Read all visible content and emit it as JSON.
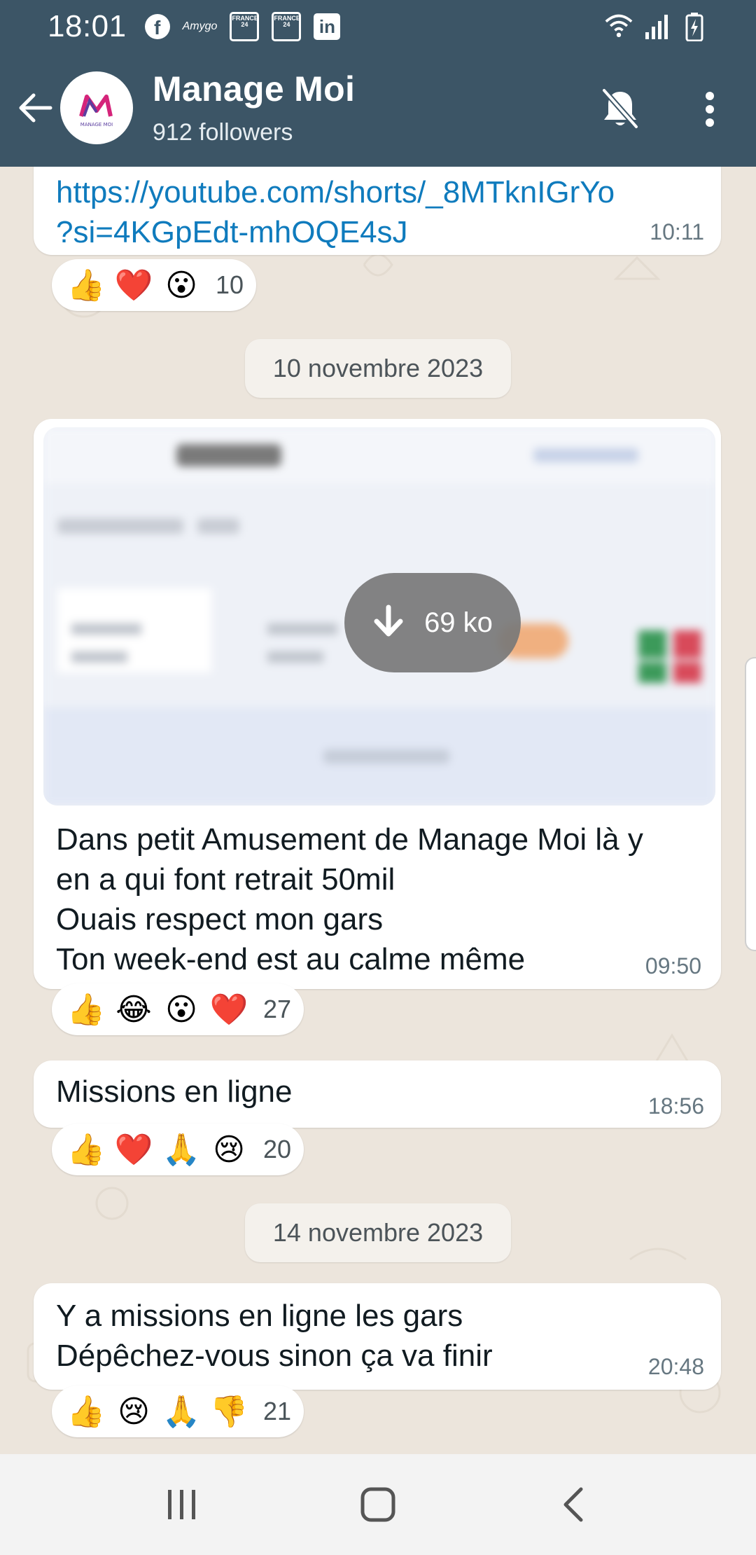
{
  "status_bar": {
    "time": "18:01",
    "notification_icons": [
      "facebook-icon",
      "amygo-icon",
      "france24-icon",
      "france24-icon",
      "linkedin-icon"
    ],
    "amygo_label": "Amygo",
    "france24_label": "FRANCE 24",
    "right_icons": [
      "wifi-icon",
      "signal-icon",
      "battery-charging-icon"
    ]
  },
  "header": {
    "title": "Manage Moi",
    "subtitle": "912 followers",
    "avatar_letter": "M",
    "avatar_caption": "MANAGE MOI",
    "actions": [
      "mute-notifications-icon",
      "more-options-icon"
    ]
  },
  "messages": [
    {
      "link_line1": "https://youtube.com/shorts/_8MTknIGrYo",
      "link_line2": "?si=4KGpEdt-mhOQE4sJ",
      "time": "10:11",
      "reactions": [
        "👍",
        "❤️",
        "😮"
      ],
      "reaction_count": "10"
    },
    {
      "date_separator": "10 novembre 2023"
    },
    {
      "image_size": "69 ko",
      "lines": [
        "Dans petit Amusement de Manage Moi là y",
        "en a qui font retrait 50mil",
        "Ouais respect mon gars",
        "Ton week-end est au calme même"
      ],
      "time": "09:50",
      "reactions": [
        "👍",
        "😂",
        "😮",
        "❤️"
      ],
      "reaction_count": "27"
    },
    {
      "text": "Missions en ligne",
      "time": "18:56",
      "reactions": [
        "👍",
        "❤️",
        "🙏",
        "😢"
      ],
      "reaction_count": "20"
    },
    {
      "date_separator": "14 novembre 2023"
    },
    {
      "lines": [
        "Y a missions en ligne les gars",
        "Dépêchez-vous sinon ça va finir"
      ],
      "time": "20:48",
      "reactions": [
        "👍",
        "😢",
        "🙏",
        "👎"
      ],
      "reaction_count": "21"
    }
  ],
  "colors": {
    "header_bg": "#3c5566",
    "chat_bg": "#ece5dc",
    "bubble_bg": "#ffffff",
    "link": "#0f7bbd",
    "time_text": "#667781"
  },
  "nav_bar": [
    "recent-apps-icon",
    "home-icon",
    "back-nav-icon"
  ]
}
